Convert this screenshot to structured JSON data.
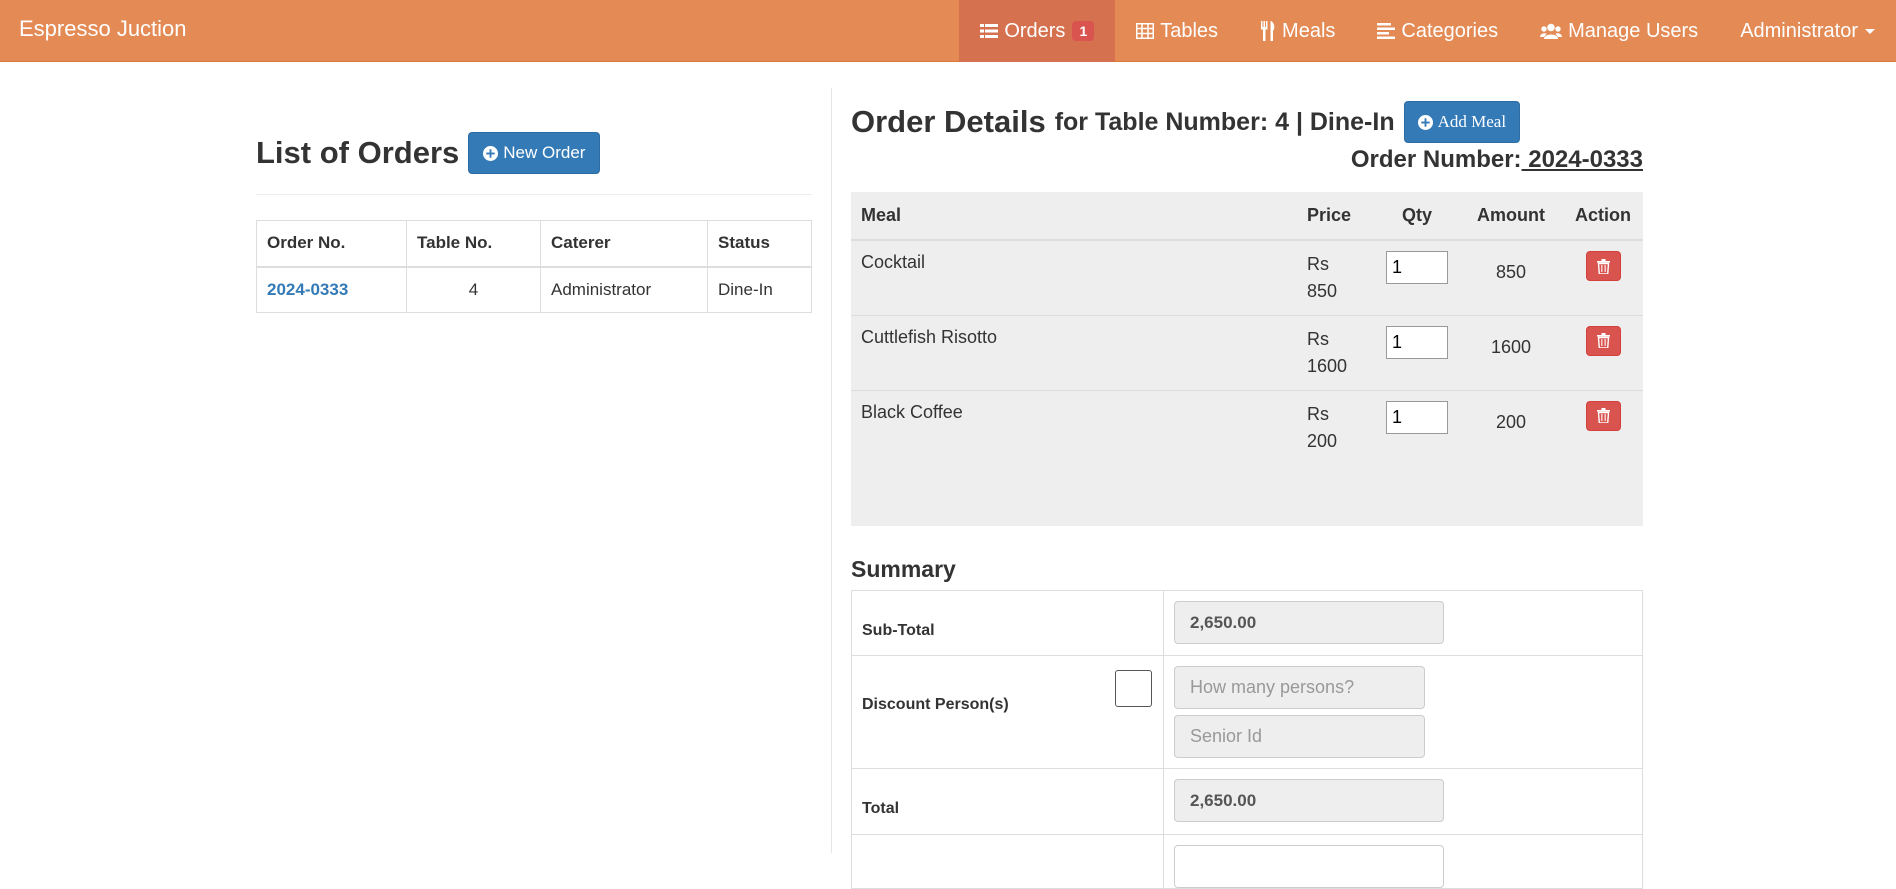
{
  "navbar": {
    "brand": "Espresso Juction",
    "items": [
      {
        "label": "Orders",
        "icon": "list-icon",
        "badge": "1",
        "active": true
      },
      {
        "label": "Tables",
        "icon": "table-icon"
      },
      {
        "label": "Meals",
        "icon": "cutlery-icon"
      },
      {
        "label": "Categories",
        "icon": "align-left-icon"
      },
      {
        "label": "Manage Users",
        "icon": "users-icon"
      },
      {
        "label": "Administrator",
        "icon": "caret-down-icon"
      }
    ]
  },
  "orders": {
    "title": "List of Orders",
    "new_order_label": "New Order",
    "columns": [
      "Order No.",
      "Table No.",
      "Caterer",
      "Status"
    ],
    "rows": [
      {
        "order_no": "2024-0333",
        "table_no": "4",
        "caterer": "Administrator",
        "status": "Dine-In"
      }
    ]
  },
  "order_details": {
    "title": "Order Details",
    "subtitle": "for Table Number: 4 | Dine-In",
    "add_meal_label": "Add Meal",
    "order_number_label": "Order Number:",
    "order_number_value": " 2024-0333",
    "columns": [
      "Meal",
      "Price",
      "Qty",
      "Amount",
      "Action"
    ],
    "meals": [
      {
        "meal": "Cocktail",
        "currency": "Rs",
        "price": "850",
        "qty": "1",
        "amount": "850"
      },
      {
        "meal": "Cuttlefish Risotto",
        "currency": "Rs",
        "price": "1600",
        "qty": "1",
        "amount": "1600"
      },
      {
        "meal": "Black Coffee",
        "currency": "Rs",
        "price": "200",
        "qty": "1",
        "amount": "200"
      }
    ]
  },
  "summary": {
    "title": "Summary",
    "subtotal_label": "Sub-Total",
    "subtotal_value": "2,650.00",
    "discount_label": "Discount Person(s)",
    "persons_placeholder": "How many persons?",
    "senior_id_placeholder": "Senior Id",
    "total_label": "Total",
    "total_value": "2,650.00"
  },
  "colors": {
    "navbar_bg": "#e38a55",
    "navbar_active": "#d5714f",
    "primary": "#337ab7",
    "danger": "#d9534f"
  }
}
